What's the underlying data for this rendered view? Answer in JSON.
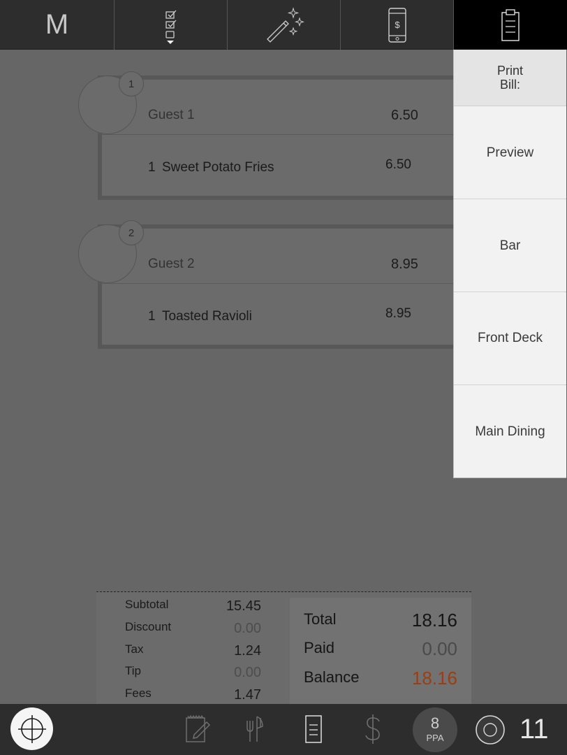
{
  "toolbar": {
    "logo": "M",
    "icons": [
      "checklist-dropdown-icon",
      "magic-wand-icon",
      "phone-payment-icon",
      "clipboard-bill-icon"
    ],
    "phone_symbol": "$"
  },
  "guests": [
    {
      "number": "1",
      "name": "Guest 1",
      "total": "6.50",
      "items": [
        {
          "qty": "1",
          "name": "Sweet Potato Fries",
          "price": "6.50"
        }
      ]
    },
    {
      "number": "2",
      "name": "Guest 2",
      "total": "8.95",
      "items": [
        {
          "qty": "1",
          "name": "Toasted Ravioli",
          "price": "8.95"
        }
      ]
    }
  ],
  "print_menu": {
    "header": "Print\nBill:",
    "options": [
      "Preview",
      "Bar",
      "Front Deck",
      "Main Dining"
    ]
  },
  "totals": {
    "subtotal_label": "Subtotal",
    "subtotal": "15.45",
    "discount_label": "Discount",
    "discount": "0.00",
    "tax_label": "Tax",
    "tax": "1.24",
    "tip_label": "Tip",
    "tip": "0.00",
    "fees_label": "Fees",
    "fees": "1.47",
    "total_label": "Total",
    "total": "18.16",
    "paid_label": "Paid",
    "paid": "0.00",
    "balance_label": "Balance",
    "balance": "18.16"
  },
  "bottom_bar": {
    "ppa_number": "8",
    "ppa_label": "PPA",
    "count": "11"
  },
  "colors": {
    "balance_due": "#9a3f12",
    "overlay": "#666666",
    "topbar": "#2d2d2d"
  }
}
